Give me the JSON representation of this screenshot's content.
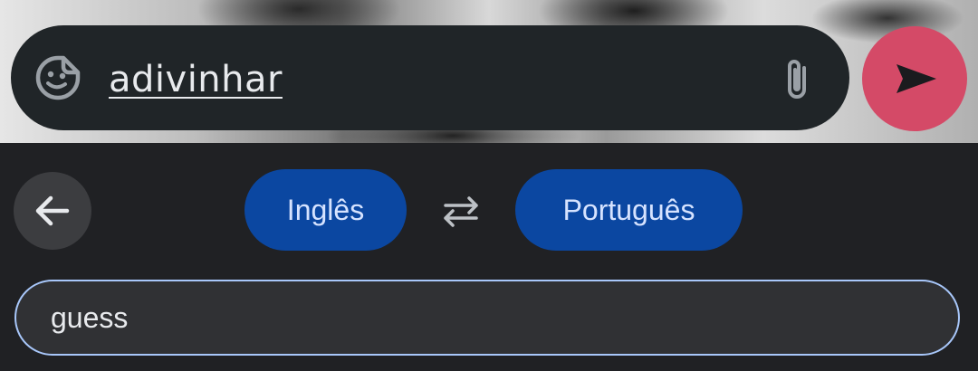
{
  "composer": {
    "text": "adivinhar",
    "sticker_icon": "sticker-icon",
    "attach_icon": "paperclip-icon",
    "send_icon": "send-icon",
    "send_color": "#d44a67"
  },
  "translate": {
    "back_icon": "arrow-back-icon",
    "source_language": "Inglês",
    "swap_icon": "swap-icon",
    "target_language": "Português",
    "input_text": "guess",
    "chip_color": "#0b47a1"
  }
}
